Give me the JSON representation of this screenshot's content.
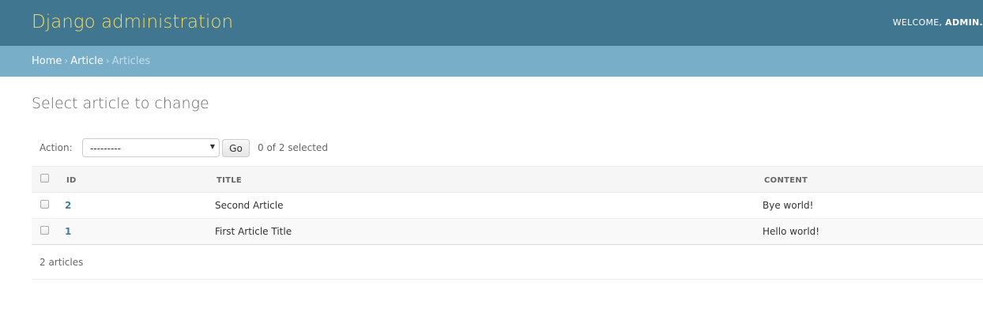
{
  "header": {
    "title": "Django administration",
    "welcome": "WELCOME,",
    "username": "ADMIN."
  },
  "breadcrumbs": {
    "home": "Home",
    "separator": "›",
    "app": "Article",
    "current": "Articles"
  },
  "page": {
    "title": "Select article to change"
  },
  "actions": {
    "label": "Action:",
    "selected_value": "---------",
    "go_label": "Go",
    "selected_count": "0 of 2 selected"
  },
  "table": {
    "columns": [
      "ID",
      "TITLE",
      "CONTENT"
    ],
    "rows": [
      {
        "id": "2",
        "title": "Second Article",
        "content": "Bye world!"
      },
      {
        "id": "1",
        "title": "First Article Title",
        "content": "Hello world!"
      }
    ]
  },
  "paginator": {
    "text": "2 articles"
  },
  "colors": {
    "header_bg": "#417690",
    "branding": "#f5dd5d",
    "breadcrumbs_bg": "#79aec8",
    "link": "#447e9b"
  }
}
